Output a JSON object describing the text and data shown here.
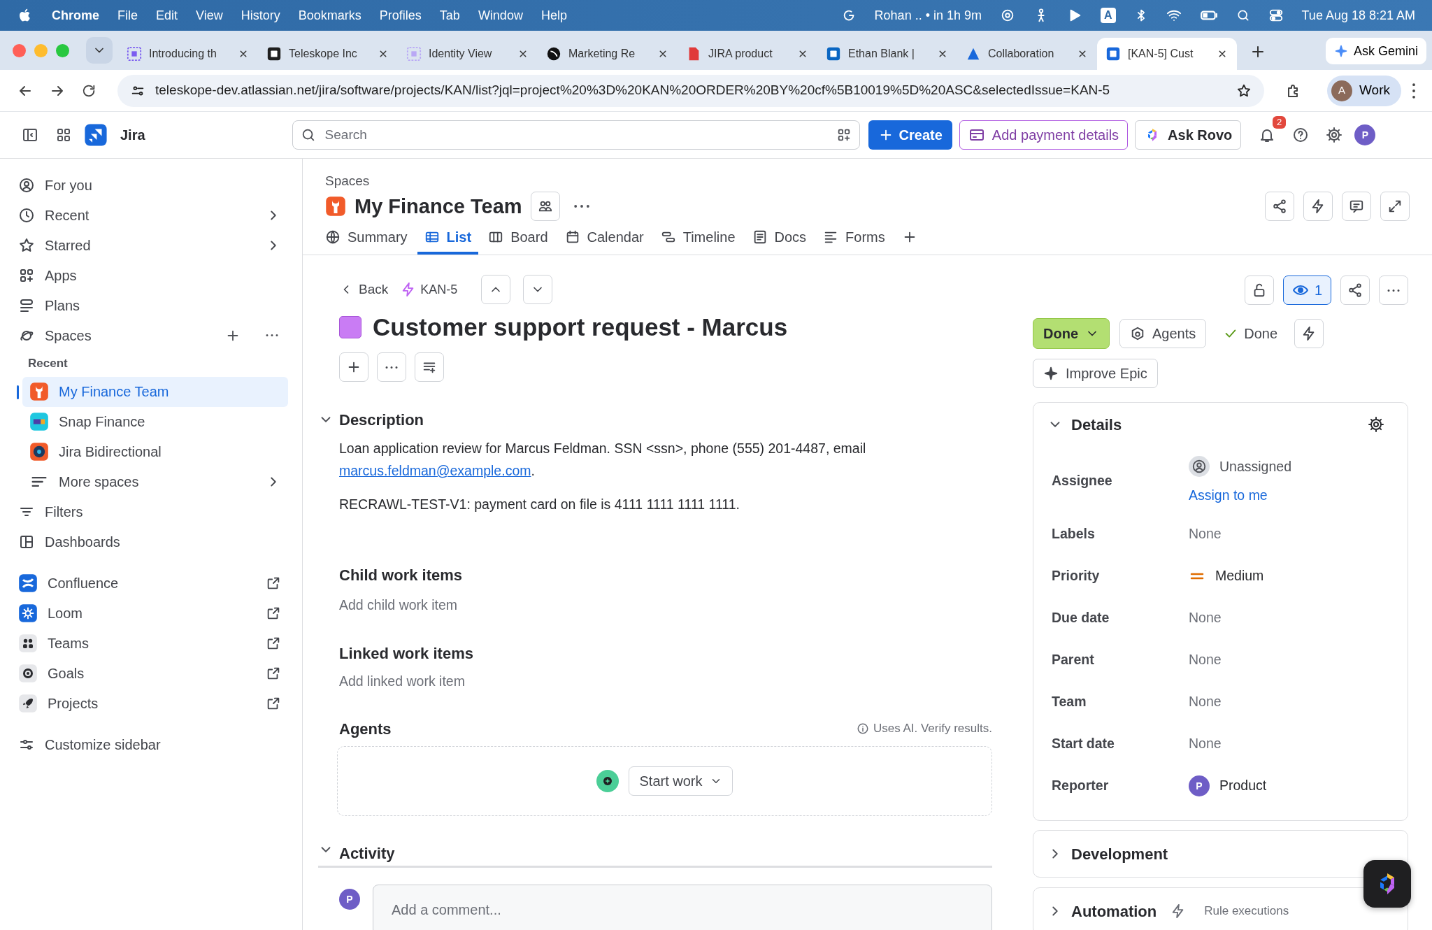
{
  "menubar": {
    "app": "Chrome",
    "menus": [
      "File",
      "Edit",
      "View",
      "History",
      "Bookmarks",
      "Profiles",
      "Tab",
      "Window",
      "Help"
    ],
    "meeting": "Rohan .. • in 1h 9m",
    "input_source": "A",
    "clock": "Tue Aug 18  8:21 AM"
  },
  "browser": {
    "tabs": [
      {
        "title": "Introducing th",
        "selected": false
      },
      {
        "title": "Teleskope Inc",
        "selected": false
      },
      {
        "title": "Identity View",
        "selected": false
      },
      {
        "title": "Marketing Re",
        "selected": false
      },
      {
        "title": "JIRA product",
        "selected": false
      },
      {
        "title": "Ethan Blank |",
        "selected": false
      },
      {
        "title": "Collaboration",
        "selected": false
      },
      {
        "title": "[KAN-5] Cust",
        "selected": true
      }
    ],
    "gemini": "Ask Gemini",
    "url": "teleskope-dev.atlassian.net/jira/software/projects/KAN/list?jql=project%20%3D%20KAN%20ORDER%20BY%20cf%5B10019%5D%20ASC&selectedIssue=KAN-5",
    "profile": {
      "initial": "A",
      "label": "Work"
    }
  },
  "topnav": {
    "product": "Jira",
    "search": {
      "placeholder": "Search"
    },
    "create": "Create",
    "payment": "Add payment details",
    "rovo": "Ask Rovo",
    "notifications": "2",
    "avatar": "P"
  },
  "sidebar": {
    "items": [
      {
        "kind": "link",
        "label": "For you",
        "selected": false
      },
      {
        "kind": "submenu",
        "label": "Recent",
        "selected": false
      },
      {
        "kind": "submenu",
        "label": "Starred",
        "selected": false
      },
      {
        "kind": "link",
        "label": "Apps",
        "selected": false
      },
      {
        "kind": "link",
        "label": "Plans",
        "selected": false
      },
      {
        "kind": "spaces",
        "label": "Spaces",
        "selected": false,
        "heading": "Recent",
        "children": [
          {
            "kind": "space",
            "label": "My Finance Team",
            "selected": true
          },
          {
            "kind": "space",
            "label": "Snap Finance",
            "selected": false
          },
          {
            "kind": "space",
            "label": "Jira Bidirectional",
            "selected": false
          },
          {
            "kind": "submenu",
            "label": "More spaces",
            "selected": false
          }
        ]
      },
      {
        "kind": "link",
        "label": "Filters",
        "selected": false
      },
      {
        "kind": "link",
        "label": "Dashboards",
        "selected": false
      },
      {
        "kind": "external",
        "label": "Confluence",
        "selected": false
      },
      {
        "kind": "external",
        "label": "Loom",
        "selected": false
      },
      {
        "kind": "external",
        "label": "Teams",
        "selected": false
      },
      {
        "kind": "external",
        "label": "Goals",
        "selected": false
      },
      {
        "kind": "external",
        "label": "Projects",
        "selected": false
      },
      {
        "kind": "link",
        "label": "Customize sidebar",
        "selected": false
      }
    ]
  },
  "space": {
    "breadcrumb": "Spaces",
    "name": "My Finance Team",
    "tabs": [
      {
        "label": "Summary",
        "selected": false
      },
      {
        "label": "List",
        "selected": true
      },
      {
        "label": "Board",
        "selected": false
      },
      {
        "label": "Calendar",
        "selected": false
      },
      {
        "label": "Timeline",
        "selected": false
      },
      {
        "label": "Docs",
        "selected": false
      },
      {
        "label": "Forms",
        "selected": false
      }
    ]
  },
  "issue": {
    "back": "Back",
    "key": "KAN-5",
    "title": "Customer support request - Marcus",
    "description": {
      "heading": "Description",
      "expanded": true,
      "paragraphs": [
        {
          "text": "Loan application review for Marcus Feldman. SSN <ssn>, phone (555) 201-4487, email",
          "link": "marcus.feldman@example.com",
          "after": "."
        },
        {
          "text": "RECRAWL-TEST-V1: payment card on file is 4111 1111 1111 1111."
        }
      ]
    },
    "child_items": {
      "heading": "Child work items",
      "action": "Add child work item"
    },
    "linked_items": {
      "heading": "Linked work items",
      "action": "Add linked work item"
    },
    "agents": {
      "heading": "Agents",
      "note": "Uses AI. Verify results.",
      "button": "Start work"
    },
    "activity": {
      "heading": "Activity",
      "expanded": true,
      "avatar": "P",
      "comment": {
        "placeholder": "Add a comment..."
      }
    }
  },
  "actions": {
    "watchers": "1",
    "watching": true,
    "status": "Done",
    "agents": "Agents",
    "resolution": "Done",
    "improve": "Improve Epic"
  },
  "details": {
    "heading": "Details",
    "expanded": true,
    "fields": [
      {
        "label": "Assignee",
        "kind": "user",
        "value": "Unassigned",
        "action": "Assign to me"
      },
      {
        "label": "Labels",
        "kind": "empty",
        "value": "None"
      },
      {
        "label": "Priority",
        "kind": "priority",
        "value": "Medium"
      },
      {
        "label": "Due date",
        "kind": "empty",
        "value": "None"
      },
      {
        "label": "Parent",
        "kind": "empty",
        "value": "None"
      },
      {
        "label": "Team",
        "kind": "empty",
        "value": "None"
      },
      {
        "label": "Start date",
        "kind": "empty",
        "value": "None"
      },
      {
        "label": "Reporter",
        "kind": "avatar",
        "value": "Product",
        "avatar": "P"
      }
    ]
  },
  "panels": [
    {
      "heading": "Development",
      "expanded": false
    },
    {
      "heading": "Automation",
      "expanded": false,
      "note": "Rule executions"
    }
  ]
}
